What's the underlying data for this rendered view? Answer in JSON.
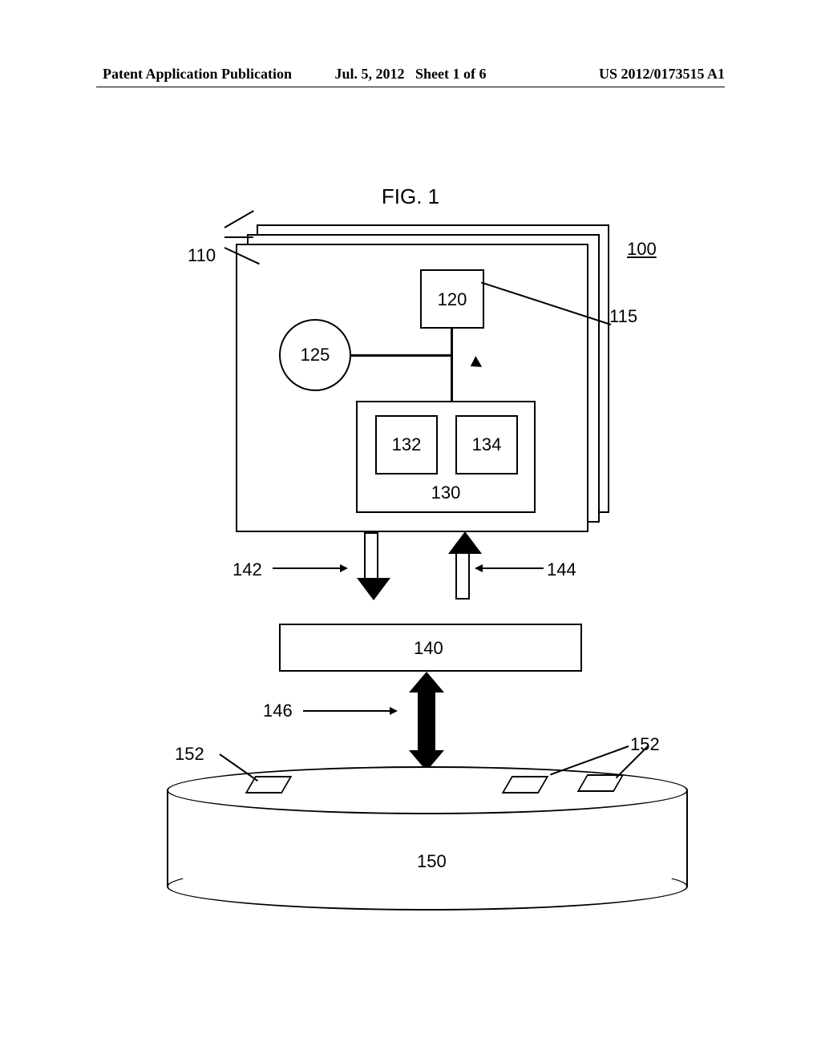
{
  "header": {
    "left": "Patent Application Publication",
    "date": "Jul. 5, 2012",
    "sheet": "Sheet 1 of 6",
    "pubno": "US 2012/0173515 A1"
  },
  "figure": {
    "title": "FIG. 1",
    "labels": {
      "l100": "100",
      "l110": "110",
      "l115": "115",
      "l120": "120",
      "l125": "125",
      "l130": "130",
      "l132": "132",
      "l134": "134",
      "l140": "140",
      "l142": "142",
      "l144": "144",
      "l146": "146",
      "l150": "150",
      "l152": "152"
    }
  }
}
